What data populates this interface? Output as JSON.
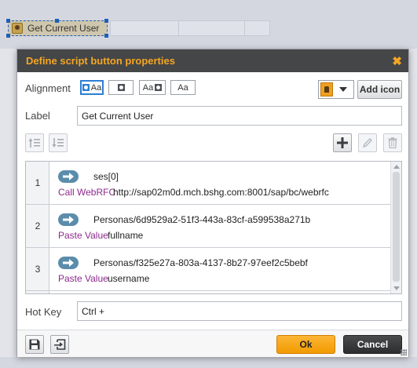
{
  "canvas": {
    "preview_button_label": "Get Current User"
  },
  "dialog": {
    "title": "Define script button properties",
    "close_glyph": "✖",
    "alignment": {
      "label": "Alignment",
      "options": [
        {
          "name": "image-left-text",
          "text": "Aa",
          "selected": true
        },
        {
          "name": "image-only",
          "text": ""
        },
        {
          "name": "text-image-right",
          "text": "Aa"
        },
        {
          "name": "text-only",
          "text": "Aa"
        }
      ]
    },
    "icon_picker": {
      "icon": "person-badge-icon",
      "color": "#f0a020"
    },
    "add_icon_label": "Add icon",
    "label_field": {
      "label": "Label",
      "value": "Get Current User"
    },
    "toolbar": {
      "move_up_icon": "move-up-icon",
      "move_down_icon": "move-down-icon",
      "add_icon": "plus-icon",
      "edit_icon": "pencil-icon",
      "delete_icon": "trash-icon"
    },
    "steps": [
      {
        "number": "1",
        "target": "ses[0]",
        "action": "Call WebRFC",
        "value": "http://sap02m0d.mch.bshg.com:8001/sap/bc/webrfc"
      },
      {
        "number": "2",
        "target": "Personas/6d9529a2-51f3-443a-83cf-a599538a271b",
        "action": "Paste Value",
        "value": "fullname"
      },
      {
        "number": "3",
        "target": "Personas/f325e27a-803a-4137-8b27-97eef2c5bebf",
        "action": "Paste Value",
        "value": "username"
      }
    ],
    "hotkey_field": {
      "label": "Hot Key",
      "value": "Ctrl +"
    },
    "footer": {
      "save_icon": "save-icon",
      "import_icon": "import-icon",
      "ok_label": "Ok",
      "cancel_label": "Cancel"
    },
    "colors": {
      "title_accent": "#f4a623",
      "action_text": "#8d2a8e",
      "ok_button": "#f29a00",
      "cancel_button": "#2c2d2f",
      "step_arrow": "#5b8dab"
    }
  }
}
